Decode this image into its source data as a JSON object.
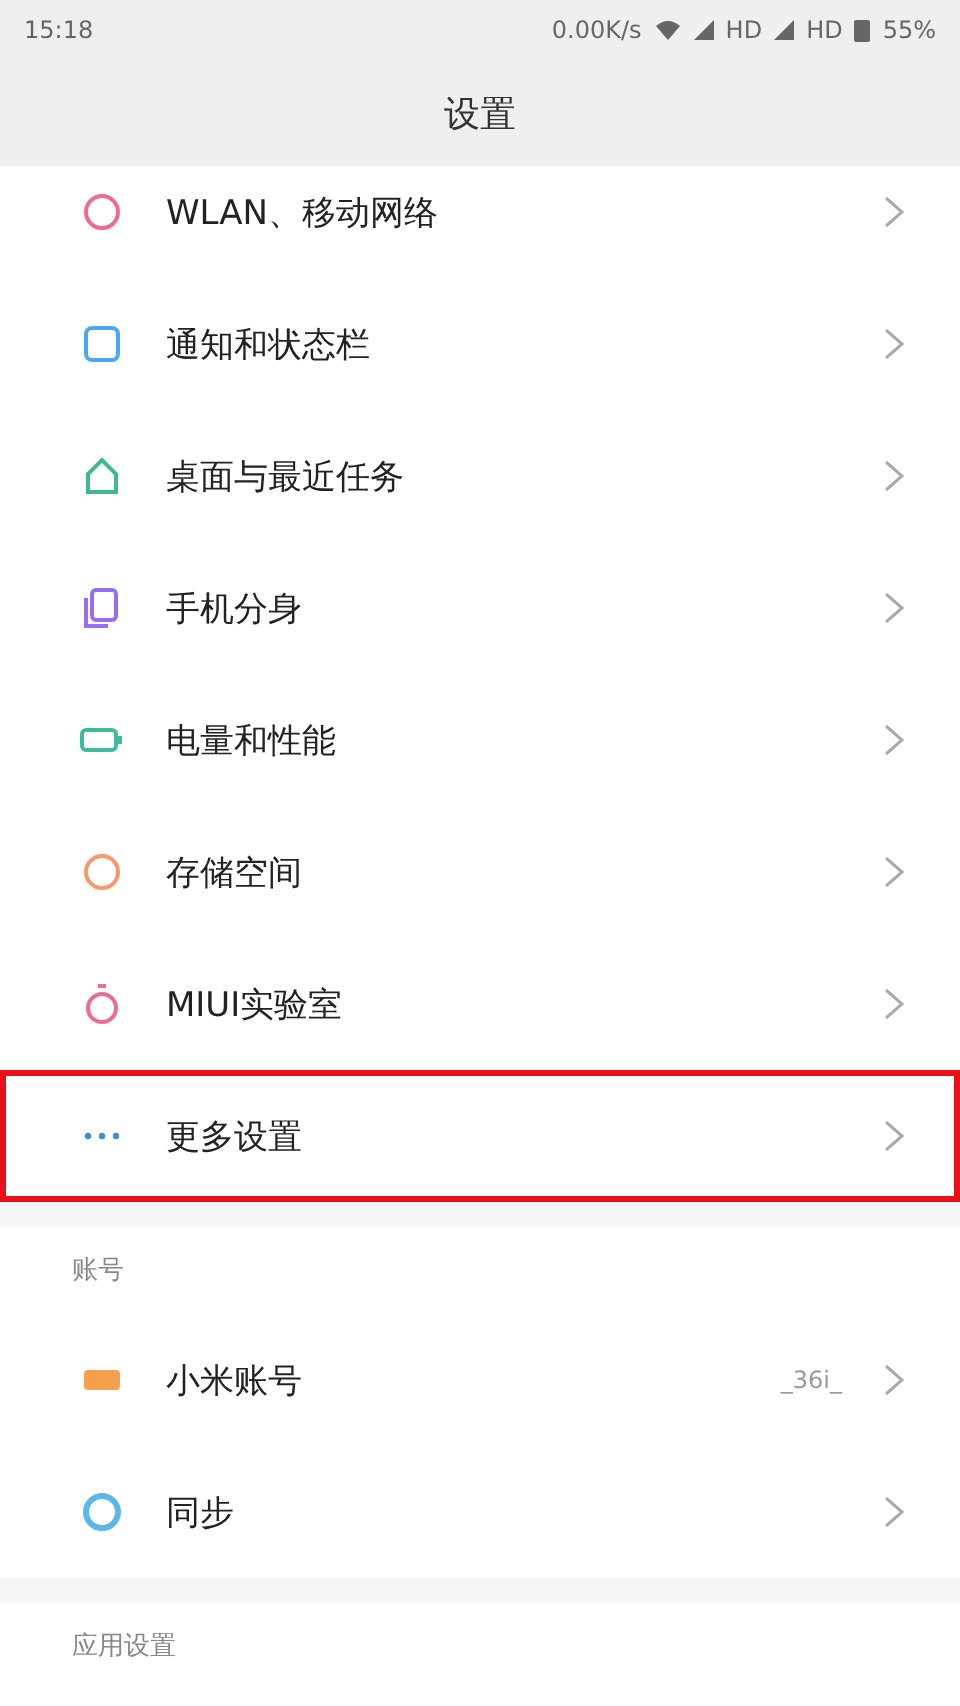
{
  "status_bar": {
    "time": "15:18",
    "speed": "0.00K/s",
    "carrier_1": "HD",
    "carrier_2": "HD",
    "battery": "55%"
  },
  "header": {
    "title": "设置"
  },
  "sections": [
    {
      "items": [
        {
          "label": "WLAN、移动网络",
          "kind": "circle",
          "color": "#f06a8c",
          "highlighted": false
        },
        {
          "label": "通知和状态栏",
          "kind": "square",
          "color": "#4aa8f0",
          "highlighted": false
        },
        {
          "label": "桌面与最近任务",
          "kind": "home",
          "color": "#3dbb8e",
          "highlighted": false
        },
        {
          "label": "手机分身",
          "kind": "copy",
          "color": "#9b6cf0",
          "highlighted": false
        },
        {
          "label": "电量和性能",
          "kind": "battery",
          "color": "#3dbb9e",
          "highlighted": false
        },
        {
          "label": "存储空间",
          "kind": "circle",
          "color": "#f59a6a",
          "highlighted": false
        },
        {
          "label": "MIUI实验室",
          "kind": "flask",
          "color": "#f06a8c",
          "highlighted": false
        },
        {
          "label": "更多设置",
          "kind": "dots",
          "color": "#3a8fd8",
          "highlighted": true
        }
      ]
    },
    {
      "title": "账号",
      "items": [
        {
          "label": "小米账号",
          "value": "_36i_",
          "kind": "card",
          "color": "#f5a04a",
          "highlighted": false
        },
        {
          "label": "同步",
          "kind": "ring",
          "color": "#5ab8e8",
          "highlighted": false
        }
      ]
    },
    {
      "title": "应用设置"
    }
  ]
}
